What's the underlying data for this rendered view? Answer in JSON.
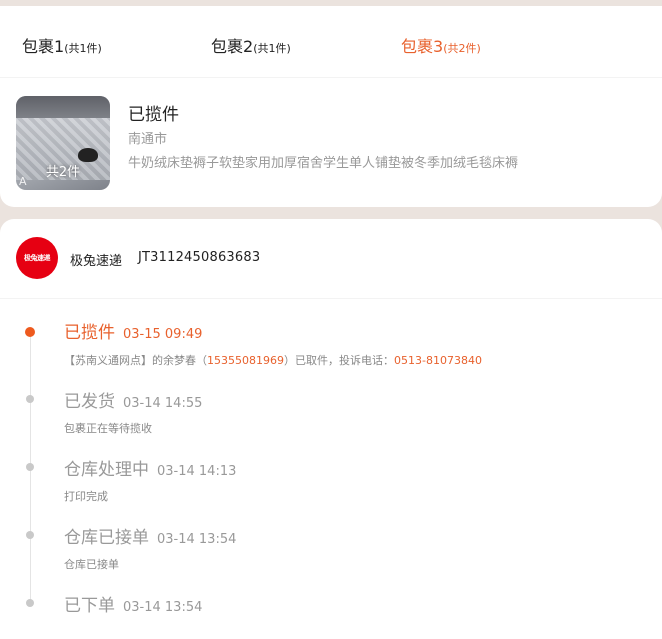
{
  "tabs": [
    {
      "label": "包裹1",
      "count": "(共1件)",
      "active": false
    },
    {
      "label": "包裹2",
      "count": "(共1件)",
      "active": false
    },
    {
      "label": "包裹3",
      "count": "(共2件)",
      "active": true
    }
  ],
  "package": {
    "status": "已揽件",
    "city": "南通市",
    "name": "牛奶绒床垫褥子软垫家用加厚宿舍学生单人铺垫被冬季加绒毛毯床褥",
    "thumb_count": "共2件",
    "thumb_mark": "A"
  },
  "courier": {
    "logo_text": "极兔速递",
    "name": "极兔速递",
    "tracking_number": "JT3112450863683"
  },
  "events": [
    {
      "title": "已揽件",
      "time": "03-15 09:49",
      "active": true,
      "desc_parts": [
        "【苏南义通网点】的余梦春（",
        "15355081969",
        "）已取件，投诉电话：",
        "0513-81073840"
      ]
    },
    {
      "title": "已发货",
      "time": "03-14 14:55",
      "active": false,
      "desc": "包裹正在等待揽收"
    },
    {
      "title": "仓库处理中",
      "time": "03-14 14:13",
      "active": false,
      "desc": "打印完成"
    },
    {
      "title": "仓库已接单",
      "time": "03-14 13:54",
      "active": false,
      "desc": "仓库已接单"
    },
    {
      "title": "已下单",
      "time": "03-14 13:54",
      "active": false,
      "desc": ""
    }
  ],
  "colors": {
    "accent": "#e8612d",
    "active_dot": "#ee5a1e",
    "courier_brand": "#e60012",
    "page_bg": "#ebe3de"
  }
}
